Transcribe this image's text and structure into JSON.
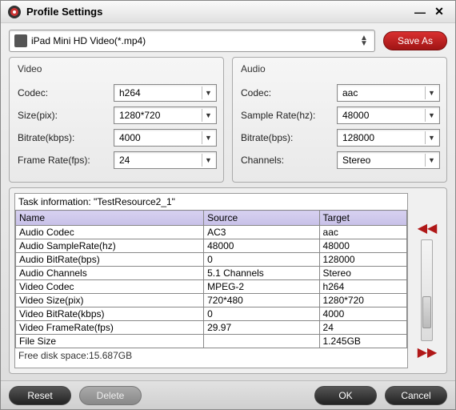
{
  "window": {
    "title": "Profile Settings"
  },
  "profile": {
    "selected": "iPad Mini HD Video(*.mp4)"
  },
  "buttons": {
    "save_as": "Save As",
    "reset": "Reset",
    "delete": "Delete",
    "ok": "OK",
    "cancel": "Cancel"
  },
  "video": {
    "title": "Video",
    "codec": {
      "label": "Codec:",
      "value": "h264"
    },
    "size": {
      "label": "Size(pix):",
      "value": "1280*720"
    },
    "bitrate": {
      "label": "Bitrate(kbps):",
      "value": "4000"
    },
    "framerate": {
      "label": "Frame Rate(fps):",
      "value": "24"
    }
  },
  "audio": {
    "title": "Audio",
    "codec": {
      "label": "Codec:",
      "value": "aac"
    },
    "samplerate": {
      "label": "Sample Rate(hz):",
      "value": "48000"
    },
    "bitrate": {
      "label": "Bitrate(bps):",
      "value": "128000"
    },
    "channels": {
      "label": "Channels:",
      "value": "Stereo"
    }
  },
  "task": {
    "title": "Task information: \"TestResource2_1\"",
    "columns": [
      "Name",
      "Source",
      "Target"
    ],
    "rows": [
      {
        "name": "Audio Codec",
        "source": "AC3",
        "target": "aac"
      },
      {
        "name": "Audio SampleRate(hz)",
        "source": "48000",
        "target": "48000"
      },
      {
        "name": "Audio BitRate(bps)",
        "source": "0",
        "target": "128000"
      },
      {
        "name": "Audio Channels",
        "source": "5.1 Channels",
        "target": "Stereo"
      },
      {
        "name": "Video Codec",
        "source": "MPEG-2",
        "target": "h264"
      },
      {
        "name": "Video Size(pix)",
        "source": "720*480",
        "target": "1280*720"
      },
      {
        "name": "Video BitRate(kbps)",
        "source": "0",
        "target": "4000"
      },
      {
        "name": "Video FrameRate(fps)",
        "source": "29.97",
        "target": "24"
      },
      {
        "name": "File Size",
        "source": "",
        "target": "1.245GB"
      }
    ],
    "free_disk": "Free disk space:15.687GB"
  }
}
